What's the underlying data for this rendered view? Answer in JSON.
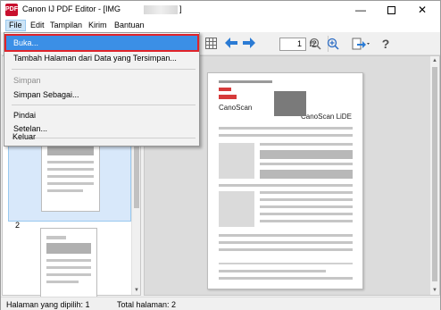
{
  "window": {
    "title": "Canon IJ PDF Editor - [IMG",
    "title_suffix": "]",
    "app_icon": "PDF",
    "minimize_label": "—",
    "close_label": "✕"
  },
  "menu": {
    "items": [
      {
        "label": "File"
      },
      {
        "label": "Edit"
      },
      {
        "label": "Tampilan"
      },
      {
        "label": "Kirim"
      },
      {
        "label": "Bantuan"
      }
    ]
  },
  "file_menu": {
    "items": [
      {
        "label": "Buka..."
      },
      {
        "label": "Tambah Halaman dari Data yang Tersimpan..."
      },
      {
        "label": "Simpan"
      },
      {
        "label": "Simpan Sebagai..."
      },
      {
        "label": "Pindai"
      },
      {
        "label": "Setelan..."
      },
      {
        "label": "Keluar"
      }
    ]
  },
  "toolbar": {
    "current_page": "1",
    "total_pages": "/2",
    "help_label": "?"
  },
  "thumbnails": {
    "second_page_number": "2"
  },
  "document": {
    "logo1": "CanoScan",
    "logo2": "CanoScan LiDE"
  },
  "status": {
    "selected_pages": "Halaman yang dipilih: 1",
    "total_pages": "Total halaman: 2"
  }
}
